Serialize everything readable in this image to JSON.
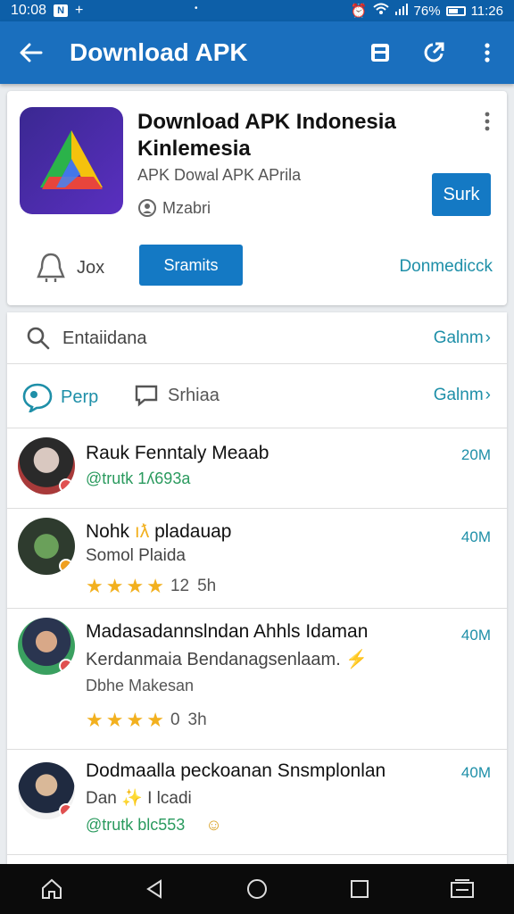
{
  "status_bar": {
    "time": "10:08",
    "dot": "•",
    "signal_text": "76%",
    "clock_right": "11:26"
  },
  "app_bar": {
    "title": "Download APK"
  },
  "app": {
    "name_line1": "Download APK Indonesia",
    "name_line2": "Kinlemesia",
    "subtitle": "APK Dowal APK APrila",
    "meta": "Mzabri",
    "install_label": "Surk",
    "bell_label": "Jox",
    "share_label": "Sramits",
    "download_link": "Donmedicck"
  },
  "search_row": {
    "label": "Entaiidana",
    "more": "Galnm"
  },
  "filter_row": {
    "filter_a": "Perp",
    "filter_b": "Srhiaa",
    "more": "Galnm"
  },
  "items": [
    {
      "title": "Rauk Fenntaly Meaab",
      "user": "@trutk 1ʎ693a",
      "time": "20M"
    },
    {
      "title": "Nohk",
      "title_tail": "pladauap",
      "subtitle": "Somol Plaida",
      "rating": "12",
      "ago": "5h",
      "time": "40M"
    },
    {
      "title": "Madasadannslndan Ahhls Idaman",
      "subtitle": "Kerdanmaia Bendanagsenlaam.",
      "line3": "Dbhe Makesan",
      "rating": "0",
      "ago": "3h",
      "time": "40M"
    },
    {
      "title": "Dodmaalla peckoanan Snsmplonlan",
      "subtitle_a": "Dan",
      "subtitle_b": "I lcadi",
      "user": "@trutk blc553",
      "time": "40M"
    }
  ],
  "colors": {
    "appbar": "#1a6fbe",
    "accent": "#1479c4",
    "link": "#1e8fa8",
    "star": "#f2b01e",
    "user": "#2a9a5e"
  }
}
